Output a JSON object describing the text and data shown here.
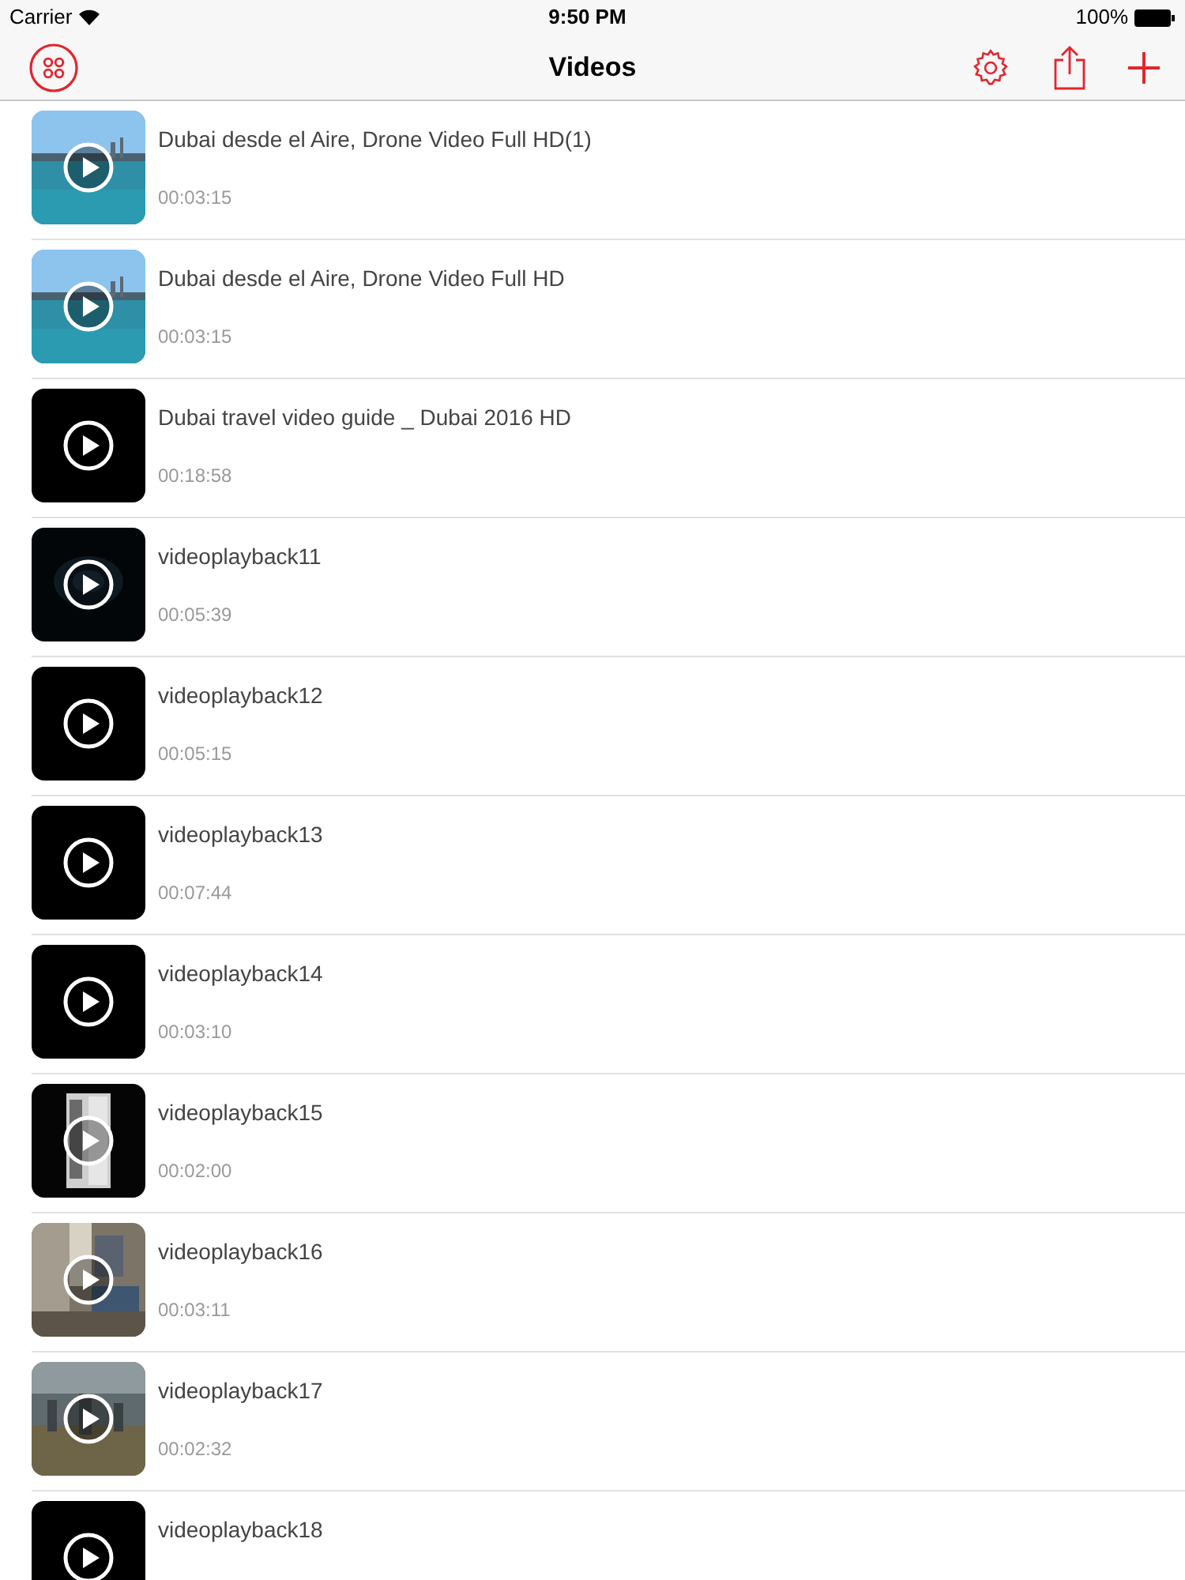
{
  "status_bar": {
    "carrier": "Carrier",
    "time": "9:50 PM",
    "battery": "100%"
  },
  "nav_bar": {
    "title": "Videos"
  },
  "videos": [
    {
      "title": "Dubai desde el Aire, Drone Video Full HD(1)",
      "duration": "00:03:15"
    },
    {
      "title": "Dubai desde el Aire, Drone Video Full HD",
      "duration": "00:03:15"
    },
    {
      "title": "Dubai travel video guide _ Dubai 2016 HD",
      "duration": "00:18:58"
    },
    {
      "title": "videoplayback11",
      "duration": "00:05:39"
    },
    {
      "title": "videoplayback12",
      "duration": "00:05:15"
    },
    {
      "title": "videoplayback13",
      "duration": "00:07:44"
    },
    {
      "title": "videoplayback14",
      "duration": "00:03:10"
    },
    {
      "title": "videoplayback15",
      "duration": "00:02:00"
    },
    {
      "title": "videoplayback16",
      "duration": "00:03:11"
    },
    {
      "title": "videoplayback17",
      "duration": "00:02:32"
    },
    {
      "title": "videoplayback18"
    }
  ]
}
